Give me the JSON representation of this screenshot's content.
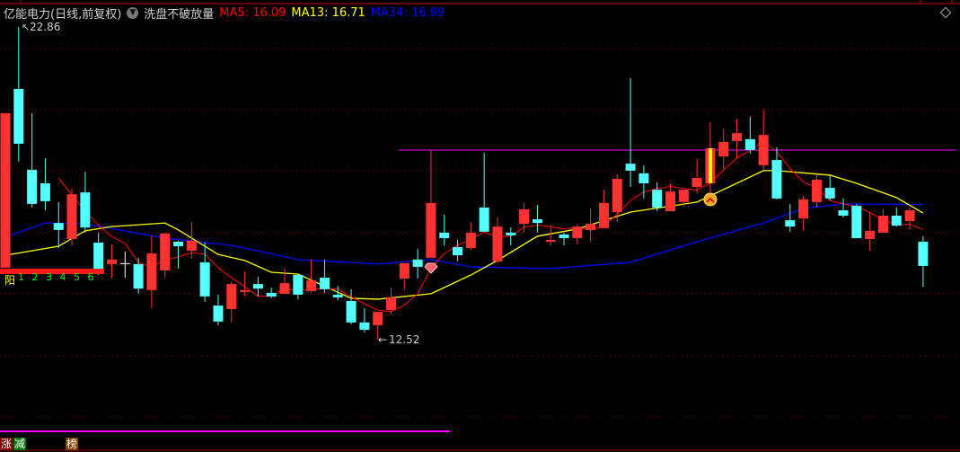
{
  "header": {
    "title": "亿能电力(日线,前复权)",
    "dropdown_icon": "chevron-down-circle-icon",
    "indicator_name": "洗盘不破放量",
    "ma5_label": "MA5: 16.09",
    "ma13_label": "MA13: 16.71",
    "ma34_label": "MA34: 16.99"
  },
  "colors": {
    "up": "#ff3232",
    "down": "#54ffff",
    "ma5": "#ff0000",
    "ma13": "#ffff00",
    "ma34": "#0000ff",
    "grid": "#8b0000",
    "hline": "#ff00ff"
  },
  "yang_label": "阳",
  "yang_numbers": [
    "1",
    "2",
    "3",
    "4",
    "5",
    "6"
  ],
  "bottom_tags": [
    "涨",
    "减",
    "榜"
  ],
  "chart_data": {
    "type": "candlestick",
    "high_label": "22.86",
    "low_label": "12.52",
    "resistance_line": 18.79,
    "signals": [
      {
        "index": 32,
        "icon": "diamond-icon"
      },
      {
        "index": 53,
        "icon": "gold-up-chevron-icon"
      }
    ],
    "candles_ohlc": [
      [
        14.9,
        20.01,
        14.9,
        20.01
      ],
      [
        20.81,
        22.86,
        18.4,
        19.0
      ],
      [
        18.14,
        20.01,
        16.89,
        17.01
      ],
      [
        17.69,
        18.52,
        16.8,
        17.1
      ],
      [
        16.38,
        17.07,
        15.55,
        16.15
      ],
      [
        15.85,
        17.51,
        15.64,
        17.33
      ],
      [
        17.39,
        18.08,
        16.06,
        16.23
      ],
      [
        15.73,
        16.06,
        14.66,
        14.75
      ],
      [
        15.02,
        15.67,
        14.57,
        15.17
      ],
      [
        15.05,
        15.43,
        14.57,
        15.05
      ],
      [
        15.02,
        15.23,
        14.04,
        14.21
      ],
      [
        14.16,
        15.97,
        13.56,
        15.37
      ],
      [
        14.81,
        16.06,
        14.57,
        16.03
      ],
      [
        15.76,
        15.79,
        14.87,
        15.61
      ],
      [
        15.46,
        16.41,
        15.2,
        15.79
      ],
      [
        15.08,
        15.73,
        13.77,
        13.95
      ],
      [
        13.65,
        14.01,
        13.0,
        13.12
      ],
      [
        13.53,
        14.42,
        13.09,
        14.36
      ],
      [
        14.1,
        14.78,
        13.95,
        14.16
      ],
      [
        14.36,
        14.6,
        13.95,
        14.21
      ],
      [
        14.07,
        14.24,
        13.89,
        13.95
      ],
      [
        14.04,
        14.87,
        14.04,
        14.39
      ],
      [
        14.66,
        14.69,
        13.86,
        14.01
      ],
      [
        14.13,
        15.17,
        14.07,
        14.48
      ],
      [
        14.57,
        15.17,
        14.07,
        14.19
      ],
      [
        14.01,
        14.3,
        13.83,
        13.92
      ],
      [
        13.8,
        14.19,
        13.03,
        13.09
      ],
      [
        13.09,
        13.56,
        12.76,
        12.85
      ],
      [
        13.0,
        13.44,
        12.52,
        13.44
      ],
      [
        13.5,
        14.24,
        13.38,
        13.92
      ],
      [
        14.54,
        15.05,
        14.16,
        15.05
      ],
      [
        15.17,
        15.52,
        14.54,
        14.93
      ],
      [
        15.23,
        18.79,
        15.23,
        17.04
      ],
      [
        16.06,
        16.65,
        15.64,
        15.88
      ],
      [
        15.58,
        15.82,
        15.11,
        15.31
      ],
      [
        15.55,
        16.41,
        15.49,
        16.06
      ],
      [
        16.89,
        18.7,
        16.09,
        16.09
      ],
      [
        15.11,
        16.56,
        15.05,
        16.26
      ],
      [
        16.06,
        16.23,
        15.64,
        15.97
      ],
      [
        16.35,
        17.04,
        16.06,
        16.83
      ],
      [
        16.5,
        16.98,
        16.06,
        16.38
      ],
      [
        15.76,
        16.32,
        15.64,
        15.82
      ],
      [
        16.0,
        16.06,
        15.64,
        15.88
      ],
      [
        15.88,
        16.35,
        15.67,
        16.26
      ],
      [
        16.15,
        16.86,
        15.76,
        16.35
      ],
      [
        16.21,
        17.48,
        16.21,
        17.04
      ],
      [
        16.74,
        17.99,
        16.41,
        17.84
      ],
      [
        18.34,
        21.17,
        17.57,
        18.11
      ],
      [
        18.02,
        18.28,
        17.19,
        17.69
      ],
      [
        17.48,
        17.72,
        16.77,
        16.89
      ],
      [
        16.77,
        17.69,
        16.77,
        17.42
      ],
      [
        17.07,
        17.48,
        16.92,
        17.48
      ],
      [
        17.57,
        18.49,
        17.36,
        17.87
      ],
      [
        17.69,
        19.71,
        17.39,
        18.85
      ],
      [
        18.58,
        19.5,
        18.14,
        19.06
      ],
      [
        19.09,
        19.8,
        18.52,
        19.35
      ],
      [
        19.15,
        19.89,
        18.67,
        18.79
      ],
      [
        18.29,
        20.1,
        18.14,
        19.29
      ],
      [
        18.46,
        18.88,
        17.16,
        17.19
      ],
      [
        16.47,
        17.01,
        16.09,
        16.26
      ],
      [
        16.53,
        17.27,
        16.12,
        17.16
      ],
      [
        17.07,
        18.05,
        16.89,
        17.81
      ],
      [
        17.54,
        17.96,
        17.13,
        17.19
      ],
      [
        16.8,
        17.19,
        16.56,
        16.62
      ],
      [
        16.95,
        17.01,
        15.88,
        15.88
      ],
      [
        15.85,
        16.74,
        15.46,
        16.12
      ],
      [
        16.06,
        16.83,
        16.06,
        16.62
      ],
      [
        16.62,
        16.89,
        16.26,
        16.29
      ],
      [
        16.44,
        16.89,
        16.18,
        16.8
      ],
      [
        15.76,
        15.94,
        14.27,
        14.96
      ]
    ],
    "ma13_points": [
      [
        0,
        15.31
      ],
      [
        4,
        15.61
      ],
      [
        6,
        16.12
      ],
      [
        8,
        16.26
      ],
      [
        12,
        16.38
      ],
      [
        13,
        16.15
      ],
      [
        16,
        15.34
      ],
      [
        18,
        15.14
      ],
      [
        20,
        14.75
      ],
      [
        22,
        14.69
      ],
      [
        26,
        13.89
      ],
      [
        28,
        13.86
      ],
      [
        32,
        14.04
      ],
      [
        35,
        14.66
      ],
      [
        37,
        15.14
      ],
      [
        40,
        15.94
      ],
      [
        43,
        16.18
      ],
      [
        47,
        16.74
      ],
      [
        52,
        17.07
      ],
      [
        57,
        18.11
      ],
      [
        58,
        18.11
      ],
      [
        62,
        17.96
      ],
      [
        64,
        17.69
      ],
      [
        67,
        17.22
      ],
      [
        69,
        16.71
      ]
    ],
    "ma34_points": [
      [
        0,
        15.91
      ],
      [
        3,
        16.38
      ],
      [
        6,
        16.35
      ],
      [
        12,
        15.88
      ],
      [
        17,
        15.64
      ],
      [
        22,
        15.17
      ],
      [
        28,
        15.02
      ],
      [
        32,
        15.17
      ],
      [
        35,
        14.93
      ],
      [
        41,
        14.87
      ],
      [
        47,
        15.08
      ],
      [
        52,
        15.76
      ],
      [
        57,
        16.38
      ],
      [
        60,
        16.86
      ],
      [
        63,
        17.01
      ],
      [
        69,
        16.99
      ]
    ]
  }
}
